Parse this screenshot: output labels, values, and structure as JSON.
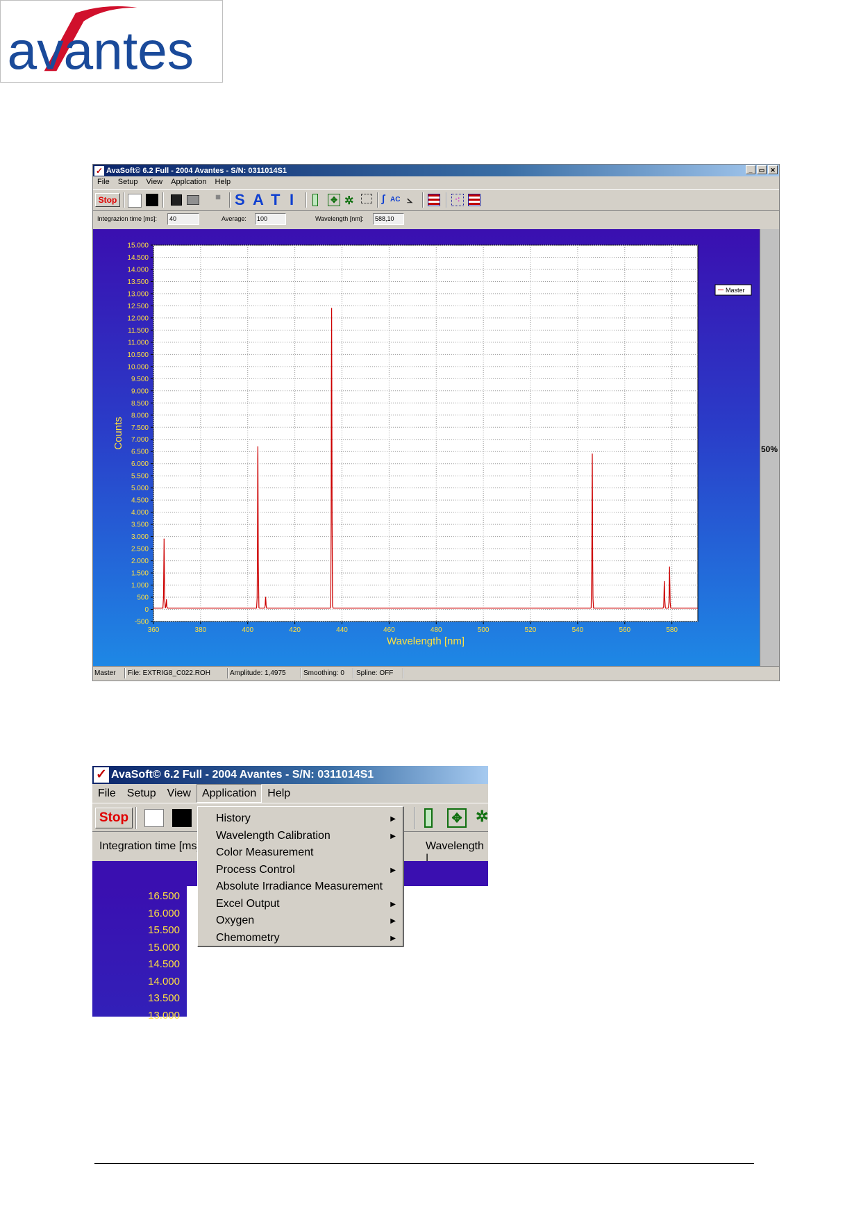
{
  "logo": {
    "text": "avantes",
    "colors": {
      "blue": "#1a4a9a",
      "red": "#d0102c"
    }
  },
  "window1": {
    "title": "AvaSoft© 6.2 Full - 2004 Avantes - S/N: 0311014S1",
    "window_buttons": [
      "_",
      "▭",
      "✕"
    ],
    "menu": [
      "File",
      "Setup",
      "View",
      "Applcation",
      "Help"
    ],
    "toolbar": {
      "stop": "Stop",
      "sati": [
        "S",
        "A",
        "T",
        "I"
      ]
    },
    "params": {
      "integration_label": "Integrazion time [ms]:",
      "integration_value": "40",
      "average_label": "Average:",
      "average_value": "100",
      "wavelength_label": "Wavelength [nm]:",
      "wavelength_value": "588,10"
    },
    "sidebar_percent": "50%",
    "status": {
      "name": "Master",
      "file": "File: EXTRIG8_C022.ROH",
      "amplitude": "Amplitude: 1,4975",
      "smoothing": "Smoothing: 0",
      "spline": "Spline: OFF"
    }
  },
  "chart_data": {
    "type": "line",
    "xlabel": "Wavelength [nm]",
    "ylabel": "Counts",
    "xlim": [
      360,
      591
    ],
    "ylim": [
      -500,
      15000
    ],
    "x_ticks": [
      "360",
      "380",
      "400",
      "420",
      "440",
      "460",
      "480",
      "500",
      "520",
      "540",
      "560",
      "580"
    ],
    "y_ticks": [
      "15.000",
      "14.500",
      "14.000",
      "13.500",
      "13.000",
      "12.500",
      "12.000",
      "11.500",
      "11.000",
      "10.500",
      "10.000",
      "9.500",
      "9.000",
      "8.500",
      "8.000",
      "7.500",
      "7.000",
      "6.500",
      "6.000",
      "5.500",
      "5.000",
      "4.500",
      "4.000",
      "3.500",
      "3.000",
      "2.500",
      "2.000",
      "1.500",
      "1.000",
      "500",
      "0",
      "-500"
    ],
    "grid": true,
    "legend": "right",
    "series": [
      {
        "name": "Master",
        "color": "#cc0000",
        "peaks": [
          {
            "x": 364.5,
            "y": 2900
          },
          {
            "x": 365.5,
            "y": 400
          },
          {
            "x": 404.3,
            "y": 6700
          },
          {
            "x": 407.6,
            "y": 500
          },
          {
            "x": 435.6,
            "y": 12400
          },
          {
            "x": 546.2,
            "y": 6400
          },
          {
            "x": 576.8,
            "y": 1150
          },
          {
            "x": 579.0,
            "y": 1750
          }
        ],
        "baseline": 50
      }
    ]
  },
  "window2": {
    "title": "AvaSoft© 6.2 Full - 2004 Avantes - S/N: 0311014S1",
    "menu": [
      "File",
      "Setup",
      "View",
      "Application",
      "Help"
    ],
    "stop": "Stop",
    "integration_label": "Integration time [ms]",
    "wavelength_label": "Wavelength |",
    "y_ticks": [
      "16.500",
      "16.000",
      "15.500",
      "15.000",
      "14.500",
      "14.000",
      "13.500",
      "13.000"
    ],
    "dropdown": [
      {
        "label": "History",
        "submenu": true
      },
      {
        "label": "Wavelength Calibration",
        "submenu": true
      },
      {
        "label": "Color Measurement",
        "submenu": false
      },
      {
        "label": "Process Control",
        "submenu": true
      },
      {
        "label": "Absolute Irradiance Measurement",
        "submenu": false
      },
      {
        "label": "Excel Output",
        "submenu": true
      },
      {
        "label": "Oxygen",
        "submenu": true
      },
      {
        "label": "Chemometry",
        "submenu": true
      }
    ]
  }
}
